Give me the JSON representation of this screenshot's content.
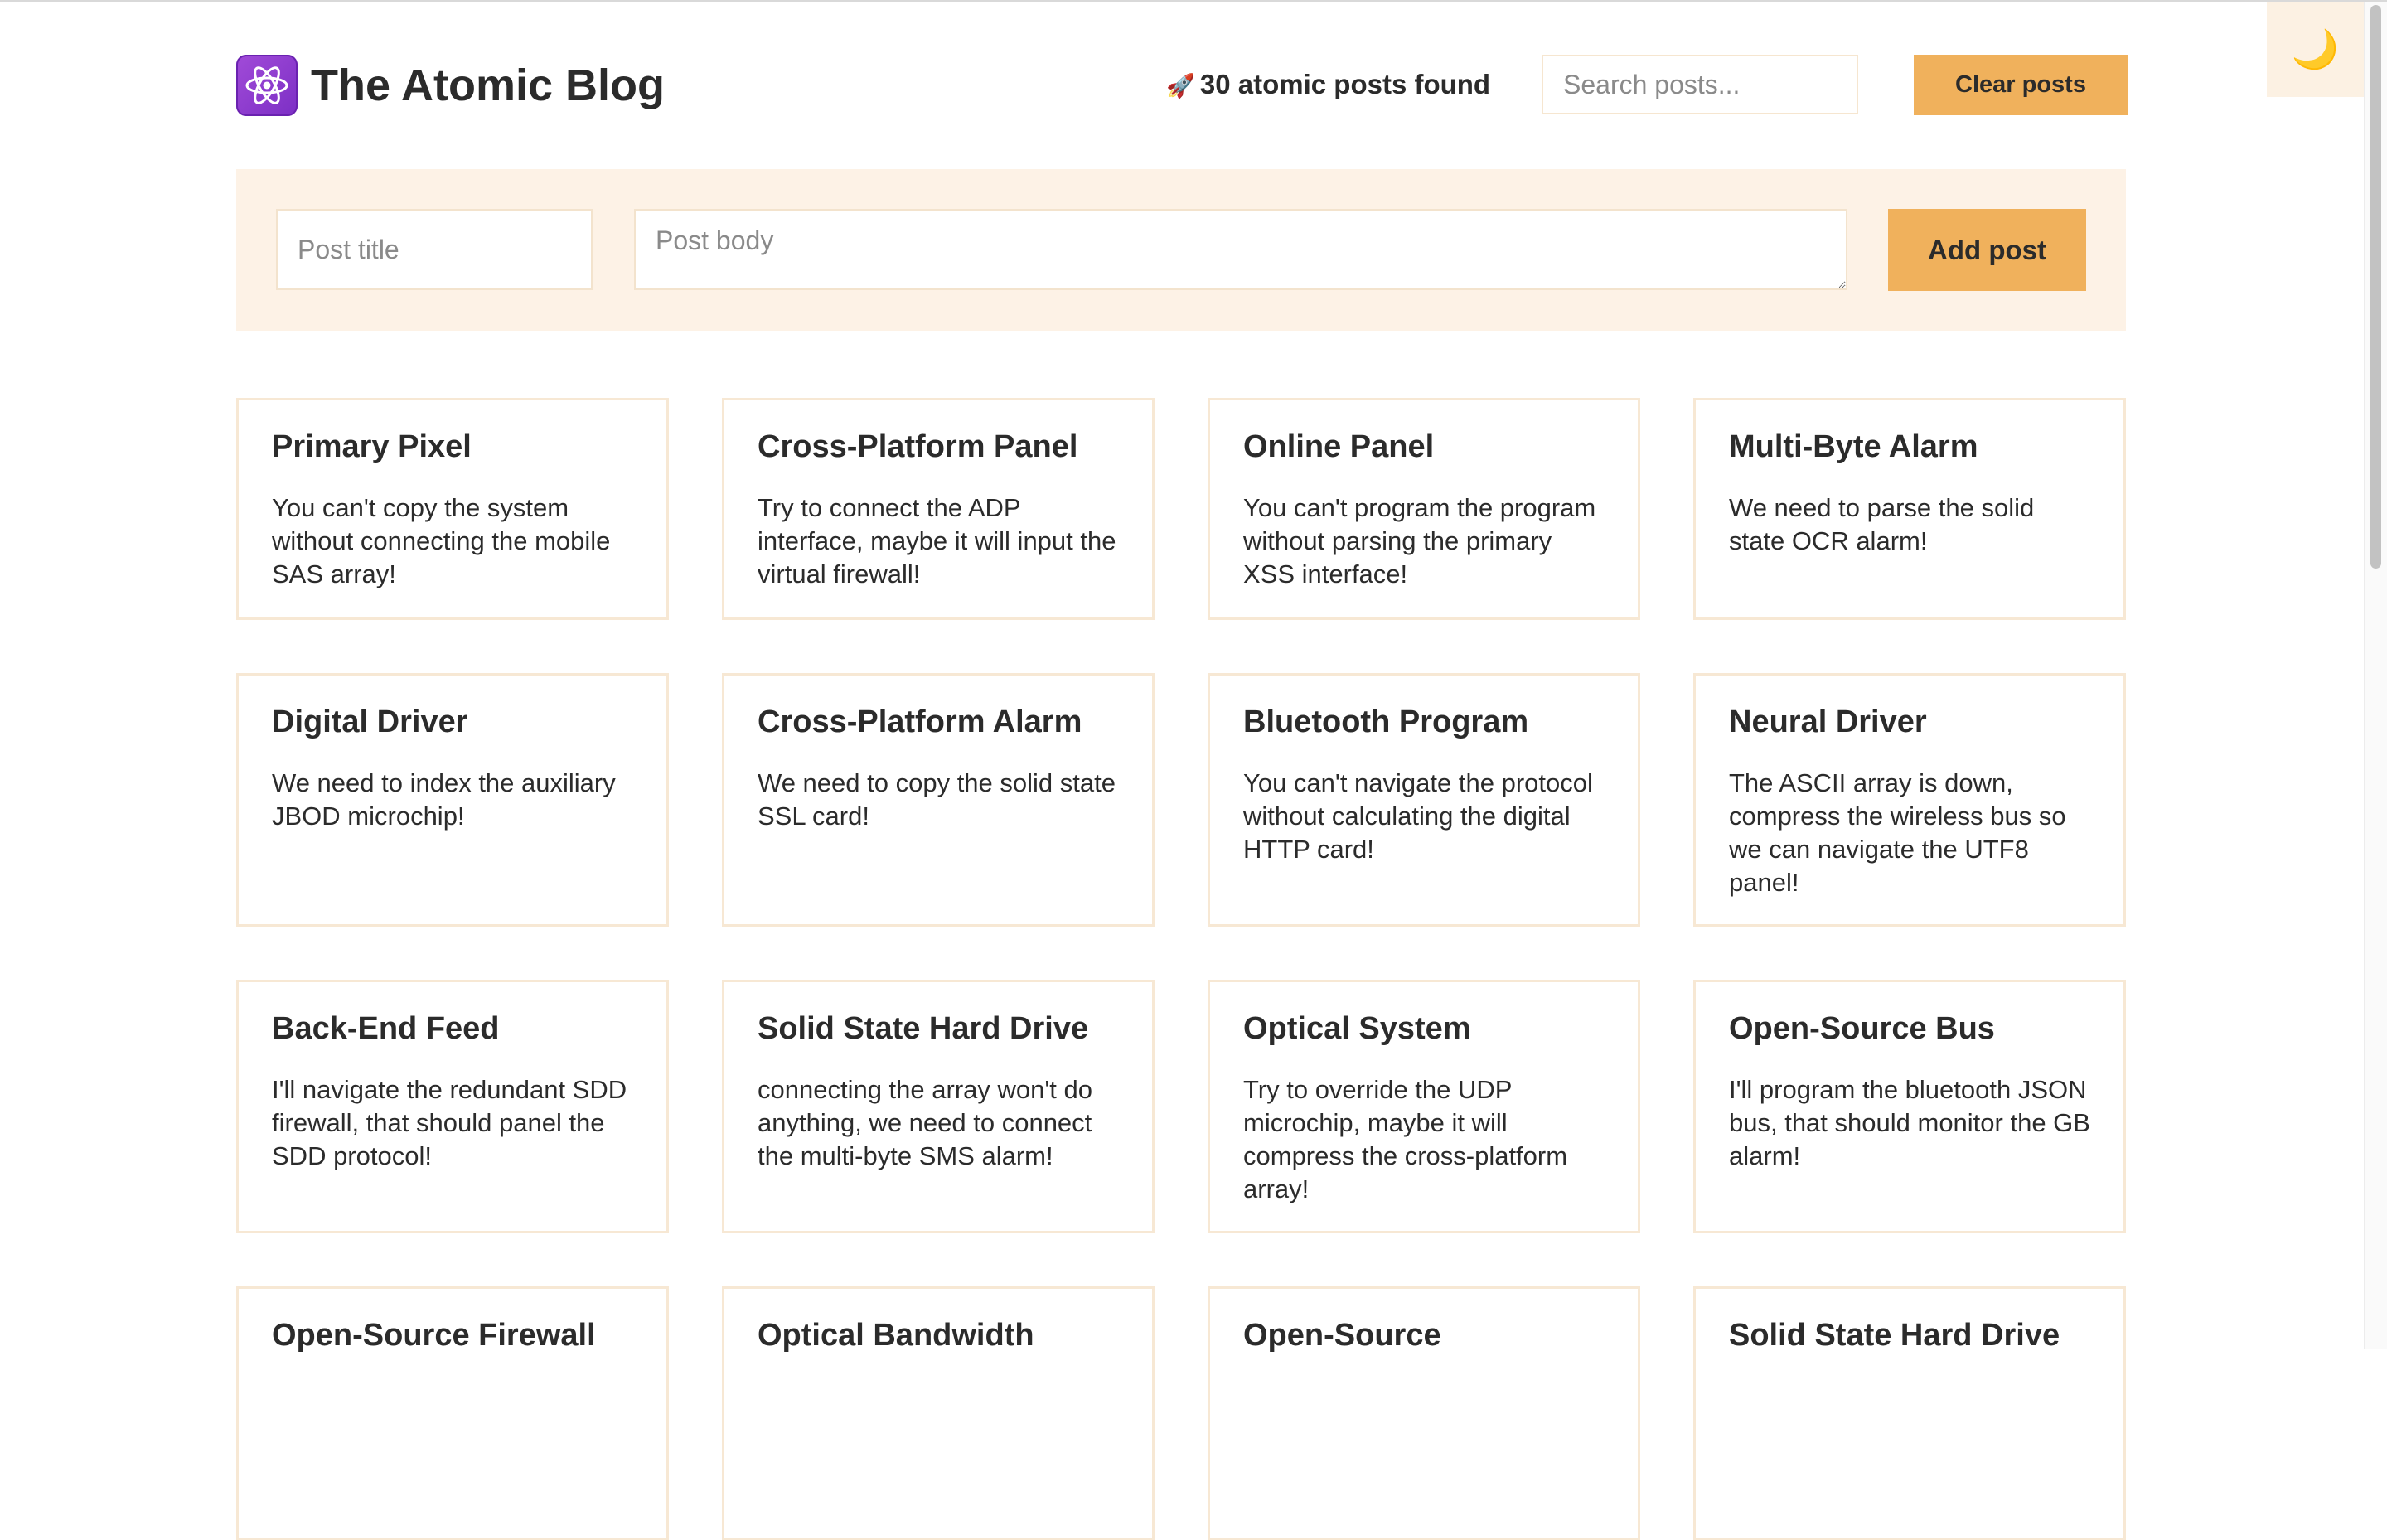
{
  "header": {
    "title": "The Atomic Blog",
    "logo_icon": "atom-icon",
    "posts_found_icon": "🚀",
    "posts_found": "30 atomic posts found",
    "search_placeholder": "Search posts...",
    "clear_label": "Clear posts",
    "dark_mode_icon": "🌙"
  },
  "form": {
    "title_placeholder": "Post title",
    "body_placeholder": "Post body",
    "add_label": "Add post"
  },
  "colors": {
    "accent": "#f0b15c",
    "panel_bg": "#fdf2e6",
    "card_border": "#f7e8d4",
    "logo": "#9b45d4"
  },
  "posts": [
    {
      "title": "Primary Pixel",
      "body": "You can't copy the system without connecting the mobile SAS array!"
    },
    {
      "title": "Cross-Platform Panel",
      "body": "Try to connect the ADP interface, maybe it will input the virtual firewall!"
    },
    {
      "title": "Online Panel",
      "body": "You can't program the program without parsing the primary XSS interface!"
    },
    {
      "title": "Multi-Byte Alarm",
      "body": "We need to parse the solid state OCR alarm!"
    },
    {
      "title": "Digital Driver",
      "body": "We need to index the auxiliary JBOD microchip!"
    },
    {
      "title": "Cross-Platform Alarm",
      "body": "We need to copy the solid state SSL card!"
    },
    {
      "title": "Bluetooth Program",
      "body": "You can't navigate the protocol without calculating the digital HTTP card!"
    },
    {
      "title": "Neural Driver",
      "body": "The ASCII array is down, compress the wireless bus so we can navigate the UTF8 panel!"
    },
    {
      "title": "Back-End Feed",
      "body": "I'll navigate the redundant SDD firewall, that should panel the SDD protocol!"
    },
    {
      "title": "Solid State Hard Drive",
      "body": "connecting the array won't do anything, we need to connect the multi-byte SMS alarm!"
    },
    {
      "title": "Optical System",
      "body": "Try to override the UDP microchip, maybe it will compress the cross-platform array!"
    },
    {
      "title": "Open-Source Bus",
      "body": "I'll program the bluetooth JSON bus, that should monitor the GB alarm!"
    },
    {
      "title": "Open-Source Firewall",
      "body": ""
    },
    {
      "title": "Optical Bandwidth",
      "body": ""
    },
    {
      "title": "Open-Source",
      "body": ""
    },
    {
      "title": "Solid State Hard Drive",
      "body": ""
    }
  ]
}
